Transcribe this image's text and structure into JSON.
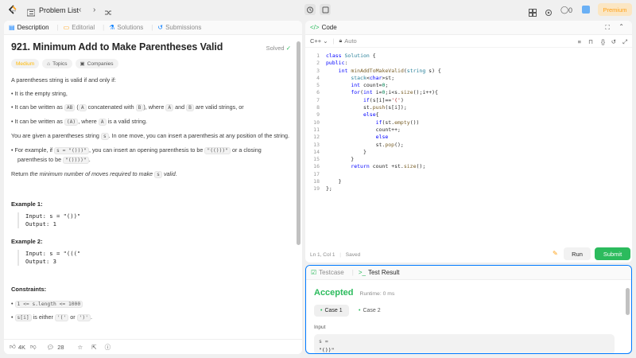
{
  "topbar": {
    "title": "Problem List",
    "streak": "0",
    "premium": "Premium"
  },
  "left_tabs": [
    "Description",
    "Editorial",
    "Solutions",
    "Submissions"
  ],
  "problem": {
    "title": "921. Minimum Add to Make Parentheses Valid",
    "status": "Solved",
    "difficulty": "Medium",
    "topics": "Topics",
    "companies": "Companies",
    "intro": "A parentheses string is valid if and only if:",
    "bullets": [
      [
        "It is the empty string,"
      ],
      [
        "It can be written as ",
        "AB",
        " (",
        "A",
        " concatenated with ",
        "B",
        "), where ",
        "A",
        " and ",
        "B",
        " are valid strings, or"
      ],
      [
        "It can be written as ",
        "(A)",
        ", where ",
        "A",
        " is a valid string."
      ]
    ],
    "move_text_a": "You are given a parentheses string ",
    "move_code": "s",
    "move_text_b": ". In one move, you can insert a parenthesis at any position of the string.",
    "example_text_a": "For example, if ",
    "example_code_a": "s = \"()))\"",
    "example_text_b": ", you can insert an opening parenthesis to be ",
    "example_code_b": "\"(()))\"",
    "example_text_c": " or a closing parenthesis to be ",
    "example_code_c": "\"())))\"",
    "example_text_d": ".",
    "return_a": "Return ",
    "return_b": "the minimum number of moves required to make ",
    "return_code": "s",
    "return_c": " valid",
    "return_d": ".",
    "example1_title": "Example 1:",
    "example1_input": "Input: s = \"())\"",
    "example1_output": "Output: 1",
    "example2_title": "Example 2:",
    "example2_input": "Input: s = \"(((\"",
    "example2_output": "Output: 3",
    "constraints_title": "Constraints:",
    "constraint1": "1 <= s.length <= 1000",
    "constraint2_code": "s[i]",
    "constraint2_a": " is either ",
    "constraint2_b": "'('",
    "constraint2_c": " or ",
    "constraint2_d": "')'",
    "constraint2_e": "."
  },
  "bottom_bar": {
    "likes": "4K",
    "comments": "28"
  },
  "code_panel": {
    "tab": "Code",
    "language": "C++",
    "mode": "Auto",
    "status_pos": "Ln 1, Col 1",
    "status_saved": "Saved",
    "run": "Run",
    "submit": "Submit"
  },
  "code_lines": [
    "class Solution {",
    "public:",
    "    int minAddToMakeValid(string s) {",
    "        stack<char>st;",
    "        int count=0;",
    "        for(int i=0;i<s.size();i++){",
    "            if(s[i]=='(')",
    "            st.push(s[i]);",
    "            else{",
    "                if(st.empty())",
    "                count++;",
    "                else",
    "                st.pop();",
    "            }",
    "        }",
    "        return count +st.size();",
    "",
    "    }",
    "};"
  ],
  "test_panel": {
    "tab1": "Testcase",
    "tab2": "Test Result",
    "result": "Accepted",
    "runtime": "Runtime: 0 ms",
    "case1": "Case 1",
    "case2": "Case 2",
    "input_label": "Input",
    "var": "s =",
    "value": "\"())\""
  },
  "colors": {
    "accent_green": "#2cbb5d",
    "medium": "#ffb800",
    "blue": "#007aff",
    "premium": "#ffa116"
  }
}
